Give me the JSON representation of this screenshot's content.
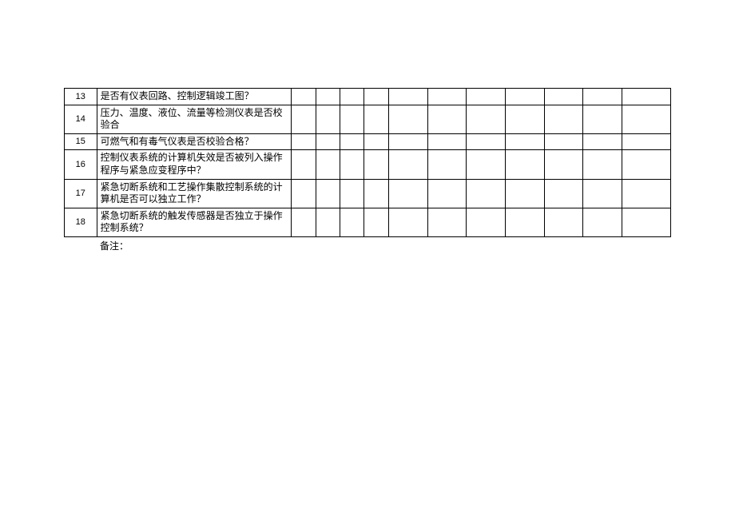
{
  "rows": [
    {
      "num": "13",
      "text": "是否有仪表回路、控制逻辑竣工图？"
    },
    {
      "num": "14",
      "text": "压力、温度、液位、流量等检测仪表是否校验合"
    },
    {
      "num": "15",
      "text": "可燃气和有毒气仪表是否校验合格？"
    },
    {
      "num": "16",
      "text": "控制仪表系统的计算机失效是否被列入操作程序与紧急应变程序中？"
    },
    {
      "num": "17",
      "text": "紧急切断系统和工艺操作集散控制系统的计算机是否可以独立工作？"
    },
    {
      "num": "18",
      "text": "紧急切断系统的触发传感器是否独立于操作控制系统？"
    }
  ],
  "footnote": "备注："
}
